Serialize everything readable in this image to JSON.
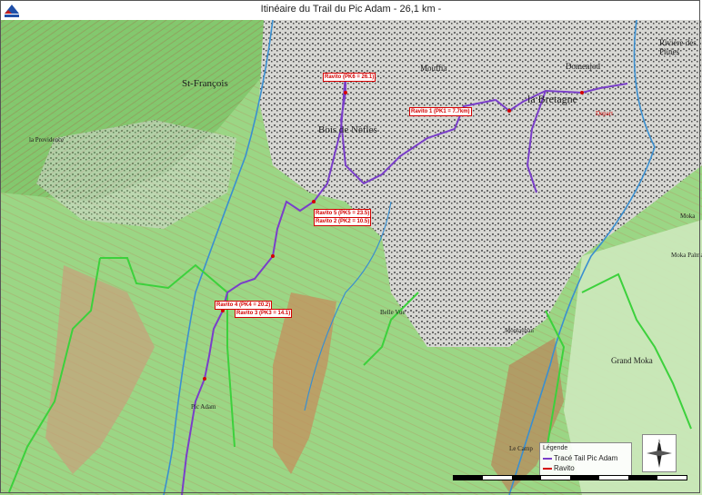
{
  "title": "Itinéaire du Trail du Pic Adam - 26,1 km -",
  "colors": {
    "route": "#7a3fc9",
    "ravito": "#d40000",
    "boundary": "#3cd13c",
    "terrain_green": "#8fd07a",
    "terrain_light": "#c9e9b8",
    "river": "#3a8fd0",
    "urban": "#9a9a9a"
  },
  "place_labels": [
    {
      "name": "St-François",
      "size": "l"
    },
    {
      "name": "la Providence",
      "size": "s"
    },
    {
      "name": "Bois de Nèfles",
      "size": "l"
    },
    {
      "name": "Mouffia",
      "size": "m"
    },
    {
      "name": "la Bretagne",
      "size": "xl"
    },
    {
      "name": "Domenjod",
      "size": "m"
    },
    {
      "name": "Rivière des Pluies",
      "size": "m"
    },
    {
      "name": "Belle Vue",
      "size": "s"
    },
    {
      "name": "Montauban",
      "size": "s"
    },
    {
      "name": "Pic Adam",
      "size": "s"
    },
    {
      "name": "Grand Moka",
      "size": "m"
    },
    {
      "name": "Moka",
      "size": "s"
    },
    {
      "name": "Moka Palmas",
      "size": "s"
    },
    {
      "name": "Le Camp",
      "size": "s"
    },
    {
      "name": "Depart",
      "size": "s"
    }
  ],
  "ravitos": [
    {
      "label": "Ravito (PK6 = 26.1)"
    },
    {
      "label": "Ravito 1 (PK1 = 7.7km)"
    },
    {
      "label": "Ravito 5 (PK5 = 23.5)"
    },
    {
      "label": "Ravito 2 (PK2 = 10.5)"
    },
    {
      "label": "Ravito 4 (PK4 = 20.2)"
    },
    {
      "label": "Ravito 3 (PK3 = 14.1)"
    }
  ],
  "legend": {
    "heading": "Légende",
    "route_label": "Tracé Tail Pic Adam",
    "ravito_label": "Ravito"
  },
  "compass_label": "N"
}
